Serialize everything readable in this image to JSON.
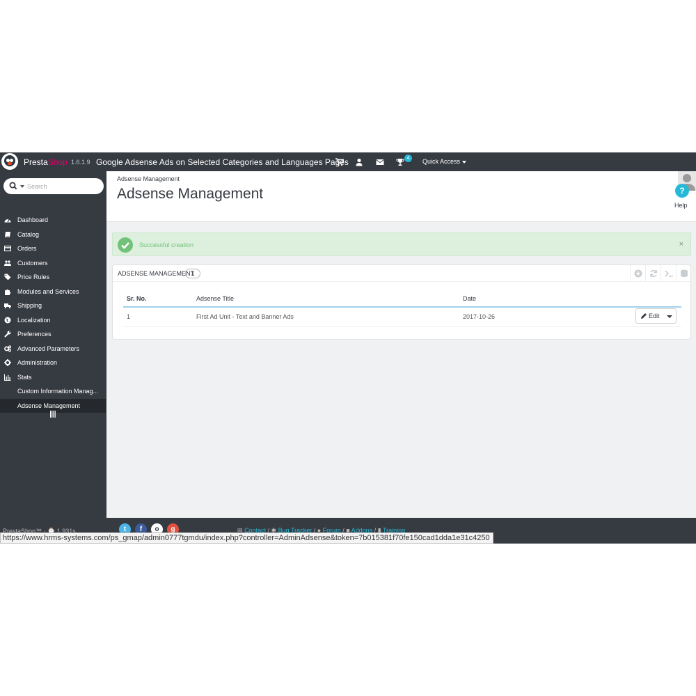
{
  "topbar": {
    "brand_presta": "Presta",
    "brand_shop": "Shop",
    "version": "1.6.1.9",
    "shop_title": "Google Adsense Ads on Selected Categories and Languages Pages",
    "notification_count": "4",
    "quick_access": "Quick Access"
  },
  "sidebar": {
    "search_placeholder": "Search",
    "items": [
      {
        "label": "Dashboard",
        "icon": "dashboard-icon"
      },
      {
        "label": "Catalog",
        "icon": "book-icon"
      },
      {
        "label": "Orders",
        "icon": "credit-card-icon"
      },
      {
        "label": "Customers",
        "icon": "users-icon"
      },
      {
        "label": "Price Rules",
        "icon": "tags-icon"
      },
      {
        "label": "Modules and Services",
        "icon": "puzzle-icon"
      },
      {
        "label": "Shipping",
        "icon": "truck-icon"
      },
      {
        "label": "Localization",
        "icon": "globe-icon"
      },
      {
        "label": "Preferences",
        "icon": "wrench-icon"
      },
      {
        "label": "Advanced Parameters",
        "icon": "cogs-icon"
      },
      {
        "label": "Administration",
        "icon": "cog-icon"
      },
      {
        "label": "Stats",
        "icon": "bar-chart-icon"
      },
      {
        "label": "Custom Information Manag..."
      },
      {
        "label": "Adsense Management",
        "active": true
      }
    ]
  },
  "header": {
    "breadcrumb": "Adsense Management",
    "title": "Adsense Management",
    "help_label": "Help"
  },
  "alert": {
    "message": "Successful creation",
    "close": "×",
    "color": "#72c279"
  },
  "panel": {
    "title": "ADSENSE MANAGEMENT",
    "count": "1",
    "columns": [
      "Sr. No.",
      "Adsense Title",
      "Date"
    ],
    "rows": [
      {
        "sr_no": "1",
        "title": "First Ad Unit - Text and Banner Ads",
        "date": "2017-10-26"
      }
    ],
    "edit_label": "Edit"
  },
  "footer": {
    "credit": "PrestaShop™ · ⌚ 1.931s",
    "links": [
      "Contact",
      "Bug Tracker",
      "Forum",
      "Addons",
      "Training"
    ]
  },
  "status_url": "https://www.hrms-systems.com/ps_gmap/admin0777tgmdu/index.php?controller=AdminAdsense&token=7b015381f70fe150cad1dda1e31c4250",
  "colors": {
    "topbar": "#363a41",
    "accent": "#25b9d7",
    "brand_pink": "#df0067",
    "success": "#72c279"
  }
}
